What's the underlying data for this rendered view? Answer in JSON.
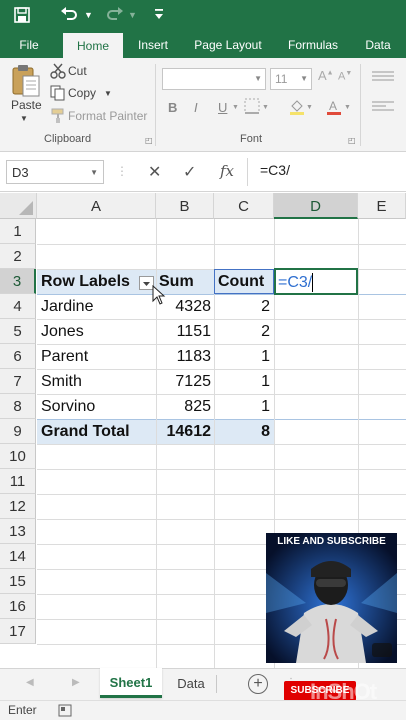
{
  "titlebar": {
    "save_icon": "save-icon",
    "undo_icon": "undo-icon",
    "redo_icon": "redo-icon",
    "more_icon": "customize-icon"
  },
  "tabs": [
    {
      "label": "File",
      "active": false
    },
    {
      "label": "Home",
      "active": true
    },
    {
      "label": "Insert",
      "active": false
    },
    {
      "label": "Page Layout",
      "active": false
    },
    {
      "label": "Formulas",
      "active": false
    },
    {
      "label": "Data",
      "active": false
    }
  ],
  "ribbon": {
    "clipboard": {
      "paste": "Paste",
      "cut": "Cut",
      "copy": "Copy",
      "format_painter": "Format Painter",
      "group_label": "Clipboard"
    },
    "font": {
      "font_name": "",
      "font_size": "11",
      "bold": "B",
      "italic": "I",
      "underline": "U",
      "group_label": "Font"
    }
  },
  "formula_bar": {
    "name_box": "D3",
    "cancel": "✕",
    "enter": "✓",
    "fx": "fx",
    "formula": "=C3/"
  },
  "columns": [
    "A",
    "B",
    "C",
    "D",
    "E"
  ],
  "rows": [
    "1",
    "2",
    "3",
    "4",
    "5",
    "6",
    "7",
    "8",
    "9",
    "10",
    "11",
    "12",
    "13",
    "14",
    "15",
    "16",
    "17"
  ],
  "pivot": {
    "headers": {
      "row_labels": "Row Labels",
      "sum": "Sum",
      "count": "Count"
    },
    "rows": [
      {
        "label": "Jardine",
        "sum": "4328",
        "count": "2"
      },
      {
        "label": "Jones",
        "sum": "1151",
        "count": "2"
      },
      {
        "label": "Parent",
        "sum": "1183",
        "count": "1"
      },
      {
        "label": "Smith",
        "sum": "7125",
        "count": "1"
      },
      {
        "label": "Sorvino",
        "sum": "825",
        "count": "1"
      }
    ],
    "total": {
      "label": "Grand Total",
      "sum": "14612",
      "count": "8"
    }
  },
  "active_cell": {
    "ref": "D3",
    "value": "=C3/"
  },
  "overlay": {
    "title": "LIKE AND SUBSCRIBE",
    "subscribe": "SUBSCRIBE",
    "watermark": "InShOt"
  },
  "sheets": [
    {
      "name": "Sheet1",
      "active": true
    },
    {
      "name": "Data",
      "active": false
    }
  ],
  "status": {
    "mode": "Enter"
  },
  "colors": {
    "excel_green": "#217346",
    "pivot_header": "#dde9f5",
    "subscribe_red": "#e00000"
  }
}
